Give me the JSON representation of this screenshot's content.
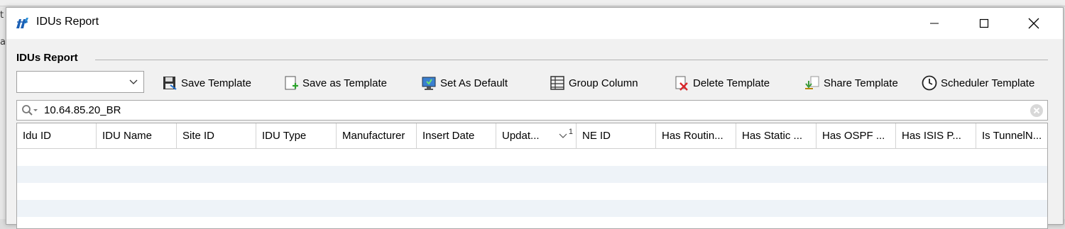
{
  "window": {
    "title": "IDUs Report"
  },
  "group": {
    "label": "IDUs Report"
  },
  "template_select": {
    "value": ""
  },
  "toolbar": [
    {
      "label": "Save Template",
      "icon": "floppy-save-icon"
    },
    {
      "label": "Save as Template",
      "icon": "save-as-icon"
    },
    {
      "label": "Set As Default",
      "icon": "monitor-default-icon"
    },
    {
      "label": "Group Column",
      "icon": "group-column-icon"
    },
    {
      "label": "Delete Template",
      "icon": "delete-template-icon"
    },
    {
      "label": "Share Template",
      "icon": "share-icon"
    },
    {
      "label": "Scheduler Template",
      "icon": "clock-icon"
    }
  ],
  "search": {
    "value": "10.64.85.20_BR"
  },
  "table": {
    "columns": [
      "Idu ID",
      "IDU Name",
      "Site ID",
      "IDU Type",
      "Manufacturer",
      "Insert Date",
      "Updat...",
      "NE ID",
      "Has Routin...",
      "Has Static ...",
      "Has OSPF ...",
      "Has ISIS P...",
      "Is TunnelN..."
    ],
    "sort": {
      "column": "Updat...",
      "order": "1"
    },
    "rows": []
  },
  "colors": {
    "alt_row": "#eef3f8",
    "border": "#a8a8a8"
  }
}
